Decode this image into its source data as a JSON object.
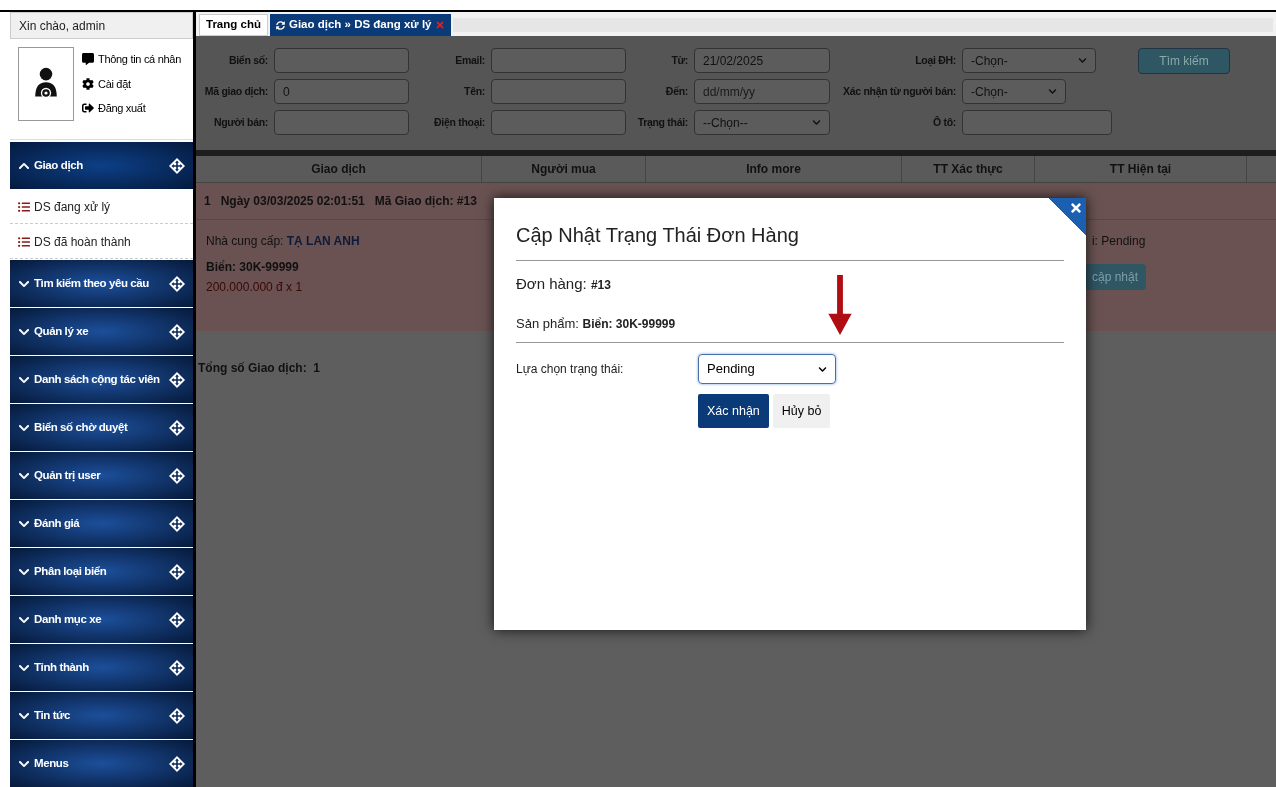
{
  "sidebar": {
    "greeting": "Xin chào, admin",
    "user_menu": [
      {
        "kind": "profile",
        "label": "Thông tin cá nhân"
      },
      {
        "kind": "settings",
        "label": "Cài đặt"
      },
      {
        "kind": "logout",
        "label": "Đăng xuất"
      }
    ],
    "nav": [
      {
        "label": "Giao dịch",
        "expanded": true,
        "children": [
          {
            "label": "DS đang xử lý"
          },
          {
            "label": "DS đã hoàn thành"
          }
        ]
      },
      {
        "label": "Tìm kiếm theo yêu cầu",
        "expanded": false
      },
      {
        "label": "Quản lý xe",
        "expanded": false
      },
      {
        "label": "Danh sách cộng tác viên",
        "expanded": false
      },
      {
        "label": "Biển số chờ duyệt",
        "expanded": false
      },
      {
        "label": "Quản trị user",
        "expanded": false
      },
      {
        "label": "Đánh giá",
        "expanded": false
      },
      {
        "label": "Phân loại biển",
        "expanded": false
      },
      {
        "label": "Danh mục xe",
        "expanded": false
      },
      {
        "label": "Tỉnh thành",
        "expanded": false
      },
      {
        "label": "Tin tức",
        "expanded": false
      },
      {
        "label": "Menus",
        "expanded": false
      }
    ]
  },
  "tabs": [
    {
      "label": "Trang chủ",
      "selected": false,
      "closable": false
    },
    {
      "label": "Giao dịch » DS đang xử lý",
      "selected": true,
      "closable": true
    }
  ],
  "filters": [
    [
      {
        "label": "Biển số:",
        "kind": "input"
      },
      {
        "label": "Mã giao dịch:",
        "kind": "input",
        "value": "0"
      },
      {
        "label": "Người bán:",
        "kind": "input"
      }
    ],
    [
      {
        "label": "Email:",
        "kind": "input"
      },
      {
        "label": "Tên:",
        "kind": "input"
      },
      {
        "label": "Điện thoại:",
        "kind": "input"
      }
    ],
    [
      {
        "label": "Từ:",
        "kind": "input",
        "value": "21/02/2025"
      },
      {
        "label": "Đến:",
        "kind": "input",
        "placeholder": "dd/mm/yy"
      },
      {
        "label": "Trạng thái:",
        "kind": "select",
        "value": "--Chọn--"
      }
    ],
    [
      {
        "label": "Loại ĐH:",
        "kind": "select",
        "value": "-Chọn-"
      },
      {
        "label": "Xác nhận từ người bán:",
        "kind": "select",
        "value": "-Chọn-"
      },
      {
        "label": "Ô tô:",
        "kind": "input"
      }
    ]
  ],
  "search_button": "Tìm kiếm",
  "table": {
    "columns": [
      "Giao dịch",
      "Người mua",
      "Info more",
      "TT Xác thực",
      "TT Hiện tại"
    ],
    "rows": [
      {
        "header": "1   Ngày 03/03/2025 02:01:51   Mã Giao dịch: #13",
        "supplier_label": "Nhà cung cấp:",
        "supplier": "TẠ LAN ANH",
        "plate": "Biển: 30K-99999",
        "price": "200.000.000 đ x 1",
        "status_partial": "i: Pending",
        "button_partial": "cập nhật"
      }
    ]
  },
  "total": "Tổng số Giao dịch:  1",
  "modal": {
    "title": "Cập Nhật Trạng Thái Đơn Hàng",
    "order_label": "Đơn hàng:",
    "order": "#13",
    "product_label": "Sản phẩm:",
    "product": "Biển: 30K-99999",
    "status_label": "Lựa chọn trạng thái:",
    "status_value": "Pending",
    "buttons": [
      {
        "label": "Xác nhận",
        "kind": "primary"
      },
      {
        "label": "Hủy bỏ",
        "kind": "secondary"
      }
    ]
  }
}
